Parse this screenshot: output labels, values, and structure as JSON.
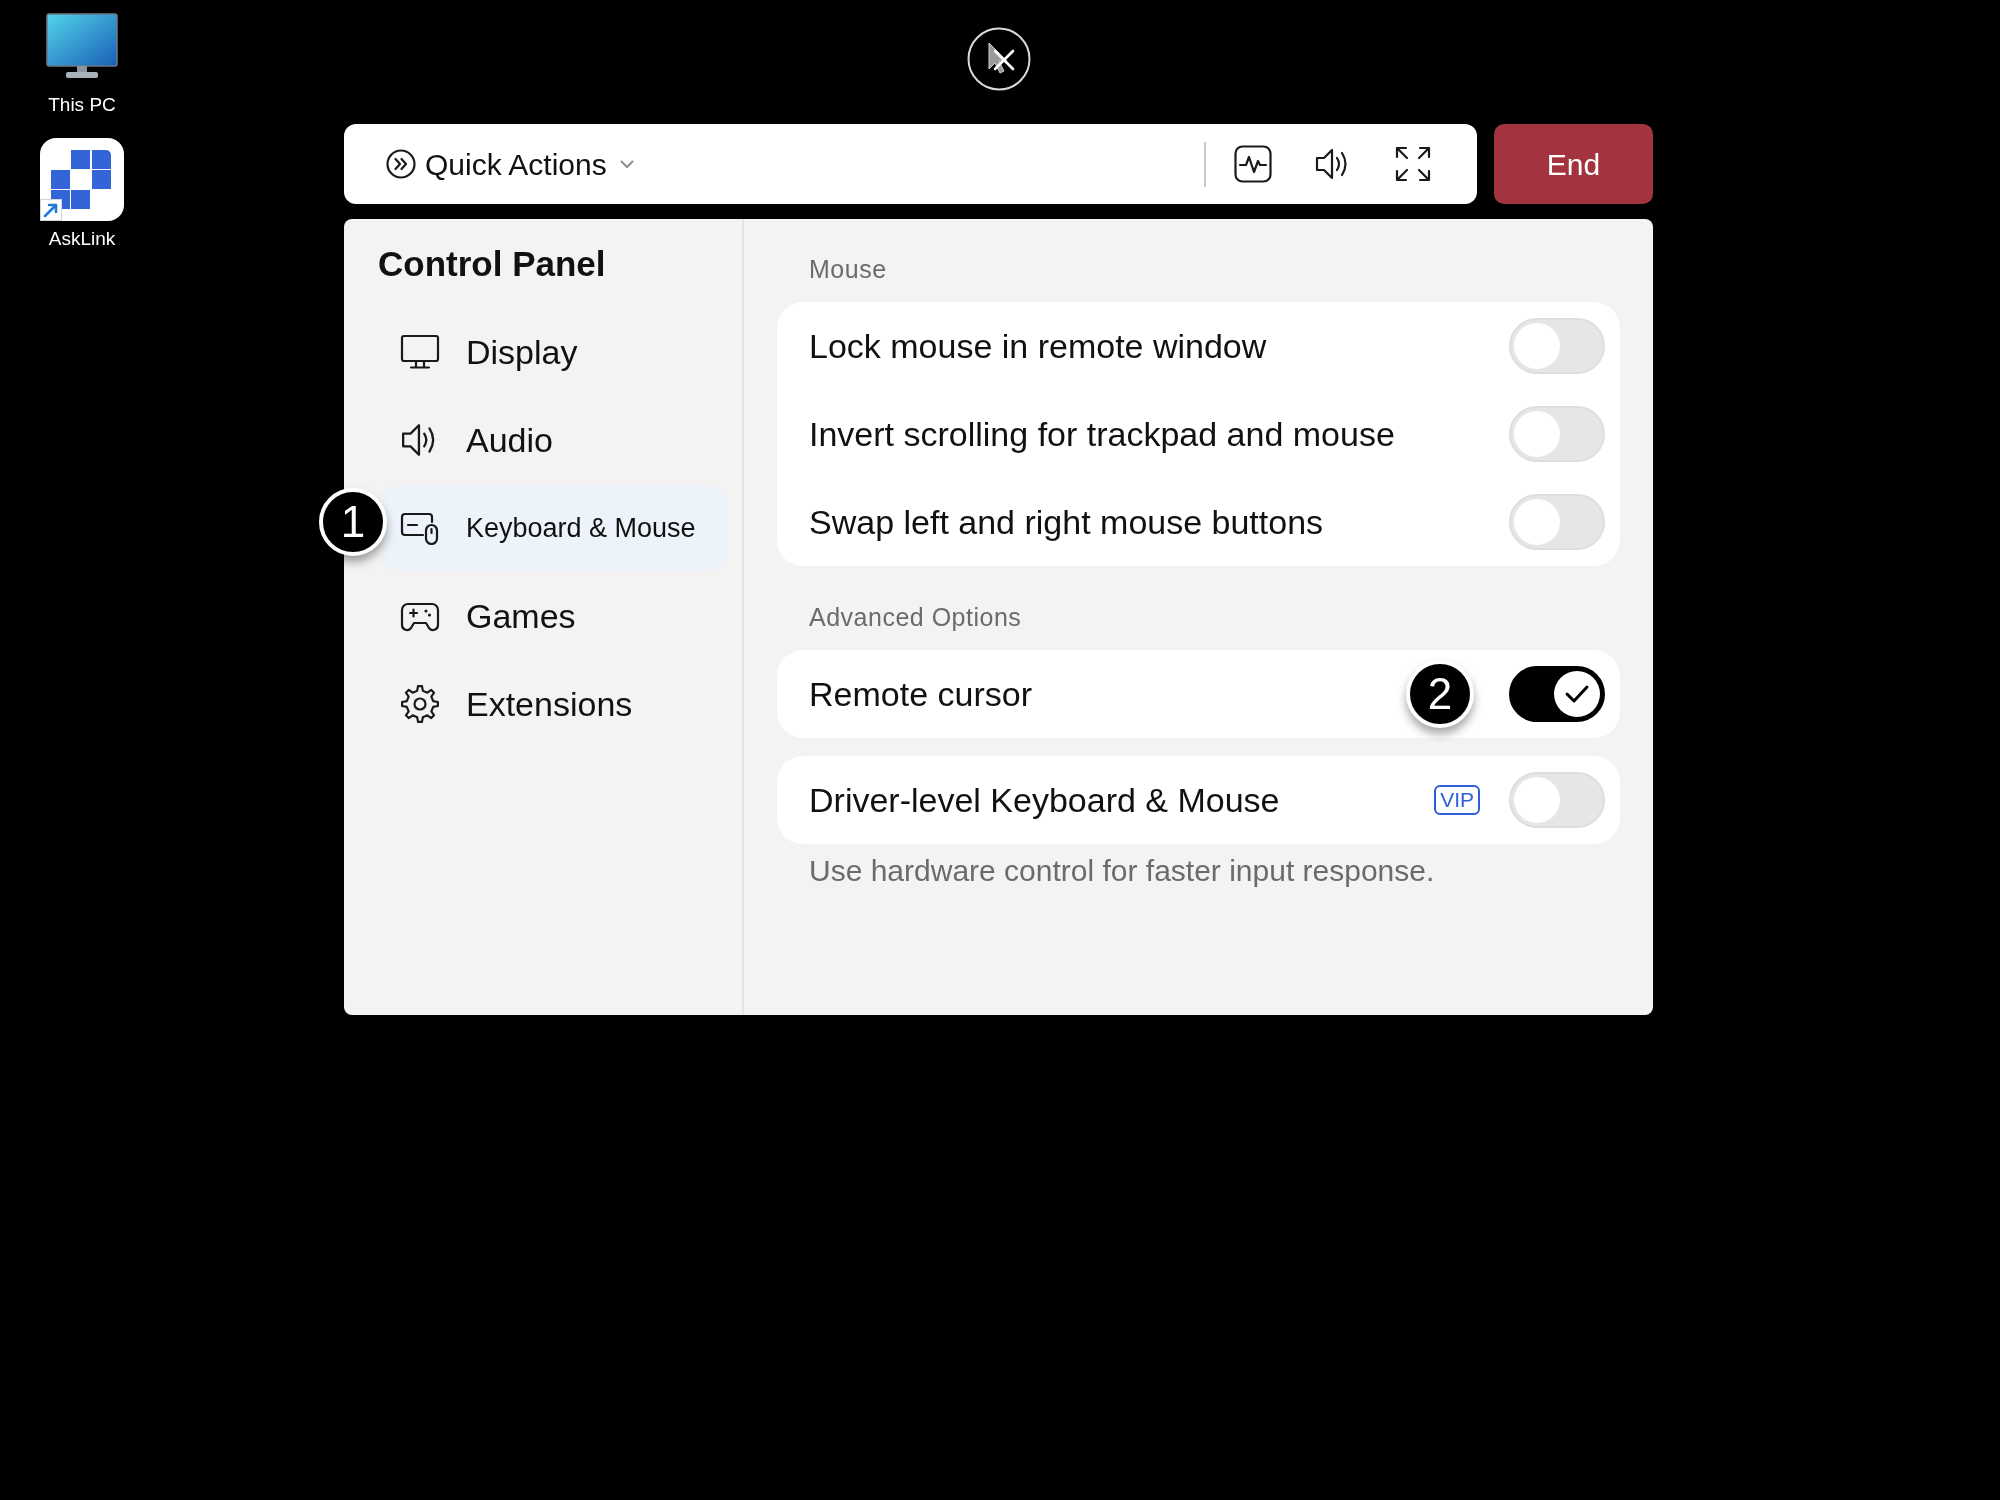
{
  "desktop": {
    "icons": [
      {
        "kind": "computer",
        "label": "This PC",
        "shortcut": false
      },
      {
        "kind": "app",
        "label": "AskLink",
        "shortcut": true
      }
    ]
  },
  "toolbar": {
    "quick_actions": "Quick Actions",
    "end_button": "End"
  },
  "control_panel": {
    "title": "Control Panel",
    "items": [
      {
        "label": "Display",
        "selected": false
      },
      {
        "label": "Audio",
        "selected": false
      },
      {
        "label": "Keyboard & Mouse",
        "selected": true,
        "marker": "1"
      },
      {
        "label": "Games",
        "selected": false
      },
      {
        "label": "Extensions",
        "selected": false
      }
    ],
    "sections": [
      {
        "heading": "Mouse",
        "cards": [
          {
            "rows": [
              {
                "label": "Lock mouse in remote window",
                "on": false
              },
              {
                "label": "Invert scrolling for trackpad and mouse",
                "on": false
              },
              {
                "label": "Swap left and right mouse buttons",
                "on": false
              }
            ]
          }
        ]
      },
      {
        "heading": "Advanced Options",
        "cards": [
          {
            "rows": [
              {
                "label": "Remote cursor",
                "on": true,
                "marker": "2"
              }
            ]
          },
          {
            "rows": [
              {
                "label": "Driver-level Keyboard & Mouse",
                "badge": "VIP",
                "on": false
              }
            ],
            "note": "Use hardware control for faster input response."
          }
        ]
      }
    ]
  }
}
